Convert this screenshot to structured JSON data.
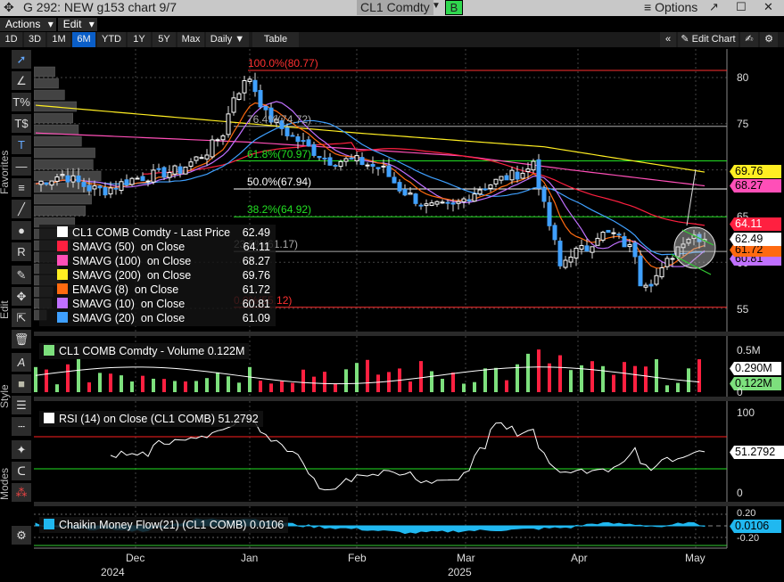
{
  "window": {
    "title": "G 292: NEW g153 chart 9/7",
    "ticker": "CL1 Comdty",
    "b_button": "B",
    "options": "Options"
  },
  "menu": [
    "Actions",
    "Edit"
  ],
  "toolbar": {
    "ranges": [
      "1D",
      "3D",
      "1M",
      "6M",
      "YTD",
      "1Y",
      "5Y",
      "Max"
    ],
    "active": "6M",
    "frequency": "Daily ▼",
    "table": "Table",
    "edit_chart": "Edit Chart"
  },
  "side_labels": {
    "favorites": "Favorites",
    "edit": "Edit",
    "style": "Style",
    "modes": "Modes"
  },
  "legend": {
    "price": [
      {
        "label": "CL1 COMB Comdty - Last Price",
        "value": "62.49",
        "color": "#ffffff"
      },
      {
        "label": "SMAVG (50)  on Close",
        "value": "64.11",
        "color": "#ff2040"
      },
      {
        "label": "SMAVG (100)  on Close",
        "value": "68.27",
        "color": "#ff4fb8"
      },
      {
        "label": "SMAVG (200)  on Close",
        "value": "69.76",
        "color": "#ffee22"
      },
      {
        "label": "EMAVG (8)  on Close",
        "value": "61.72",
        "color": "#ff6a10"
      },
      {
        "label": "SMAVG (10)  on Close",
        "value": "60.81",
        "color": "#c070ff"
      },
      {
        "label": "SMAVG (20)  on Close",
        "value": "61.09",
        "color": "#3fa0ff"
      }
    ],
    "volume": "CL1 COMB Comdty - Volume 0.122M",
    "rsi": "RSI (14)  on Close (CL1 COMB) 51.2792",
    "cmf": "Chaikin Money Flow(21) (CL1 COMB) 0.0106"
  },
  "fib_levels": [
    {
      "label": "100.0%(80.77)",
      "price": 80.77,
      "color": "#ff3030"
    },
    {
      "label": "76.4%(74.72)",
      "price": 74.72,
      "color": "#aaaaaa"
    },
    {
      "label": "61.8%(70.97)",
      "price": 70.97,
      "color": "#22e022"
    },
    {
      "label": "50.0%(67.94)",
      "price": 67.94,
      "color": "#ffffff"
    },
    {
      "label": "38.2%(64.92)",
      "price": 64.92,
      "color": "#22e022"
    },
    {
      "label": "23.6%(61.17)",
      "price": 61.17,
      "color": "#aaaaaa"
    },
    {
      "label": "0.0%(55.12)",
      "price": 55.12,
      "color": "#ff3030"
    }
  ],
  "price_axis": [
    "80",
    "75",
    "65",
    "60",
    "55"
  ],
  "price_tags": [
    {
      "value": "69.76",
      "bg": "#ffee22",
      "fg": "#000"
    },
    {
      "value": "68.27",
      "bg": "#ff4fb8",
      "fg": "#000"
    },
    {
      "value": "64.11",
      "bg": "#ff2040",
      "fg": "#fff"
    },
    {
      "value": "62.49",
      "bg": "#ffffff",
      "fg": "#000"
    },
    {
      "value": "61.72",
      "bg": "#ff6a10",
      "fg": "#000"
    },
    {
      "value": "60.81",
      "bg": "#c070ff",
      "fg": "#000"
    }
  ],
  "volume_axis": {
    "top": "0.5M",
    "avg": "0.290M",
    "last": "0.122M",
    "zero": "0"
  },
  "rsi_axis": {
    "top": "100",
    "last": "51.2792",
    "zero": "0"
  },
  "cmf_axis": {
    "top": "0.20",
    "last": "0.0106",
    "bottom": "-0.20"
  },
  "time_axis": {
    "months": [
      "Dec",
      "Jan",
      "Feb",
      "Mar",
      "Apr",
      "May"
    ],
    "years": [
      "2024",
      "2025"
    ]
  },
  "chart_data": {
    "type": "candlestick",
    "price_keypoints": [
      [
        0,
        68.5
      ],
      [
        5,
        69.5
      ],
      [
        10,
        68
      ],
      [
        13,
        67.8
      ],
      [
        18,
        69
      ],
      [
        27,
        70
      ],
      [
        32,
        72
      ],
      [
        35,
        74
      ],
      [
        37,
        78
      ],
      [
        40,
        80
      ],
      [
        43,
        76
      ],
      [
        47,
        74
      ],
      [
        52,
        72
      ],
      [
        55,
        71
      ],
      [
        60,
        71
      ],
      [
        65,
        70
      ],
      [
        68,
        68
      ],
      [
        73,
        66
      ],
      [
        78,
        66
      ],
      [
        83,
        68
      ],
      [
        87,
        69
      ],
      [
        92,
        70
      ],
      [
        93,
        71
      ],
      [
        95,
        66
      ],
      [
        97,
        62
      ],
      [
        98,
        59.5
      ],
      [
        100,
        61
      ],
      [
        103,
        61.5
      ],
      [
        105,
        63
      ],
      [
        108,
        63
      ],
      [
        112,
        61
      ],
      [
        113,
        58
      ],
      [
        115,
        58
      ],
      [
        117,
        59
      ],
      [
        118,
        60
      ],
      [
        121,
        62.5
      ],
      [
        123,
        63
      ],
      [
        125,
        62.49
      ]
    ],
    "sma200_keypoints": [
      [
        0,
        77
      ],
      [
        60,
        74
      ],
      [
        95,
        72.5
      ],
      [
        125,
        69.76
      ]
    ],
    "sma100_keypoints": [
      [
        0,
        74
      ],
      [
        40,
        73
      ],
      [
        80,
        71.5
      ],
      [
        100,
        70
      ],
      [
        125,
        68.27
      ]
    ],
    "cmf_keypoints": [
      [
        0,
        0.02
      ],
      [
        10,
        -0.05
      ],
      [
        20,
        -0.08
      ],
      [
        30,
        0.1
      ],
      [
        40,
        0.12
      ],
      [
        50,
        0.0
      ],
      [
        60,
        -0.05
      ],
      [
        70,
        -0.12
      ],
      [
        80,
        -0.08
      ],
      [
        90,
        -0.06
      ],
      [
        100,
        -0.02
      ],
      [
        105,
        0.04
      ],
      [
        112,
        0.02
      ],
      [
        118,
        -0.02
      ],
      [
        121,
        0.05
      ],
      [
        125,
        0.0106
      ]
    ]
  }
}
